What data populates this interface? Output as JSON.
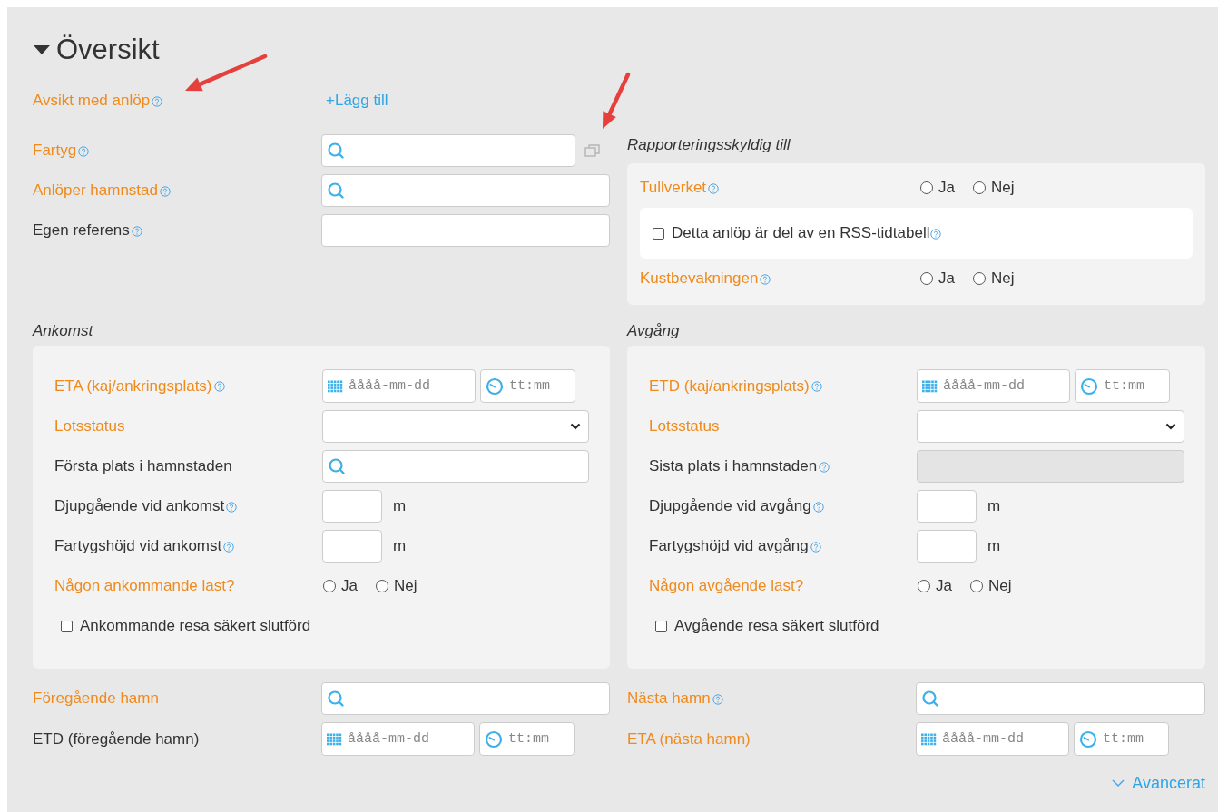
{
  "section": {
    "title": "Översikt",
    "expanded": true
  },
  "annotations": [
    {
      "kind": "arrow"
    },
    {
      "kind": "arrow"
    }
  ],
  "intent": {
    "label": "Avsikt med anlöp",
    "required": true,
    "help": true,
    "add_link": "+Lägg till"
  },
  "vessel_fields": [
    {
      "kind": "search",
      "label": "Fartyg",
      "required": true,
      "help": true,
      "copy_button": true
    },
    {
      "kind": "search",
      "label": "Anlöper hamnstad",
      "required": true,
      "help": true
    },
    {
      "kind": "text",
      "label": "Egen referens",
      "required": false,
      "help": true,
      "disabled": false
    }
  ],
  "reporting": {
    "title": "Rapporteringsskyldig till",
    "items": [
      {
        "kind": "radio",
        "label": "Tullverket",
        "required": true,
        "help": true,
        "options": [
          {
            "label": "Ja",
            "selected": false
          },
          {
            "label": "Nej",
            "selected": false
          }
        ]
      },
      {
        "kind": "checkbox",
        "label": "Detta anlöp är del av en RSS-tidtabell",
        "help": true,
        "checked": false,
        "boxed": true
      },
      {
        "kind": "radio",
        "label": "Kustbevakningen",
        "required": true,
        "help": true,
        "options": [
          {
            "label": "Ja",
            "selected": false
          },
          {
            "label": "Nej",
            "selected": false
          }
        ]
      }
    ]
  },
  "arrival": {
    "title": "Ankomst",
    "fields": [
      {
        "kind": "datetime",
        "label": "ETA (kaj/ankringsplats)",
        "required": true,
        "help": true,
        "date_placeholder": "åååå-mm-dd",
        "time_placeholder": "tt:mm"
      },
      {
        "kind": "select",
        "label": "Lotsstatus",
        "required": true,
        "help": false
      },
      {
        "kind": "search",
        "label": "Första plats i hamnstaden",
        "required": false,
        "help": false
      },
      {
        "kind": "number",
        "label": "Djupgående vid ankomst",
        "required": false,
        "help": true,
        "unit": "m"
      },
      {
        "kind": "number",
        "label": "Fartygshöjd vid ankomst",
        "required": false,
        "help": true,
        "unit": "m"
      },
      {
        "kind": "radio",
        "label": "Någon ankommande last?",
        "required": true,
        "help": false,
        "options": [
          {
            "label": "Ja",
            "selected": false
          },
          {
            "label": "Nej",
            "selected": false
          }
        ]
      },
      {
        "kind": "checkbox",
        "label": "Ankommande resa säkert slutförd",
        "help": false,
        "checked": false,
        "boxed": false
      }
    ]
  },
  "departure": {
    "title": "Avgång",
    "fields": [
      {
        "kind": "datetime",
        "label": "ETD (kaj/ankringsplats)",
        "required": true,
        "help": true,
        "date_placeholder": "åååå-mm-dd",
        "time_placeholder": "tt:mm"
      },
      {
        "kind": "select",
        "label": "Lotsstatus",
        "required": true,
        "help": false
      },
      {
        "kind": "text",
        "label": "Sista plats i hamnstaden",
        "required": false,
        "help": true,
        "disabled": true
      },
      {
        "kind": "number",
        "label": "Djupgående vid avgång",
        "required": false,
        "help": true,
        "unit": "m"
      },
      {
        "kind": "number",
        "label": "Fartygshöjd vid avgång",
        "required": false,
        "help": true,
        "unit": "m"
      },
      {
        "kind": "radio",
        "label": "Någon avgående last?",
        "required": true,
        "help": false,
        "options": [
          {
            "label": "Ja",
            "selected": false
          },
          {
            "label": "Nej",
            "selected": false
          }
        ]
      },
      {
        "kind": "checkbox",
        "label": "Avgående resa säkert slutförd",
        "help": false,
        "checked": false,
        "boxed": false
      }
    ]
  },
  "previous_port": [
    {
      "kind": "search",
      "label": "Föregående hamn",
      "required": true,
      "help": false
    },
    {
      "kind": "datetime",
      "label": "ETD (föregående hamn)",
      "required": false,
      "help": false,
      "date_placeholder": "åååå-mm-dd",
      "time_placeholder": "tt:mm"
    }
  ],
  "next_port": [
    {
      "kind": "search",
      "label": "Nästa hamn",
      "required": true,
      "help": true
    },
    {
      "kind": "datetime",
      "label": "ETA (nästa hamn)",
      "required": true,
      "help": false,
      "date_placeholder": "åååå-mm-dd",
      "time_placeholder": "tt:mm"
    }
  ],
  "advanced_link": {
    "label": "Avancerat",
    "expanded": false
  }
}
